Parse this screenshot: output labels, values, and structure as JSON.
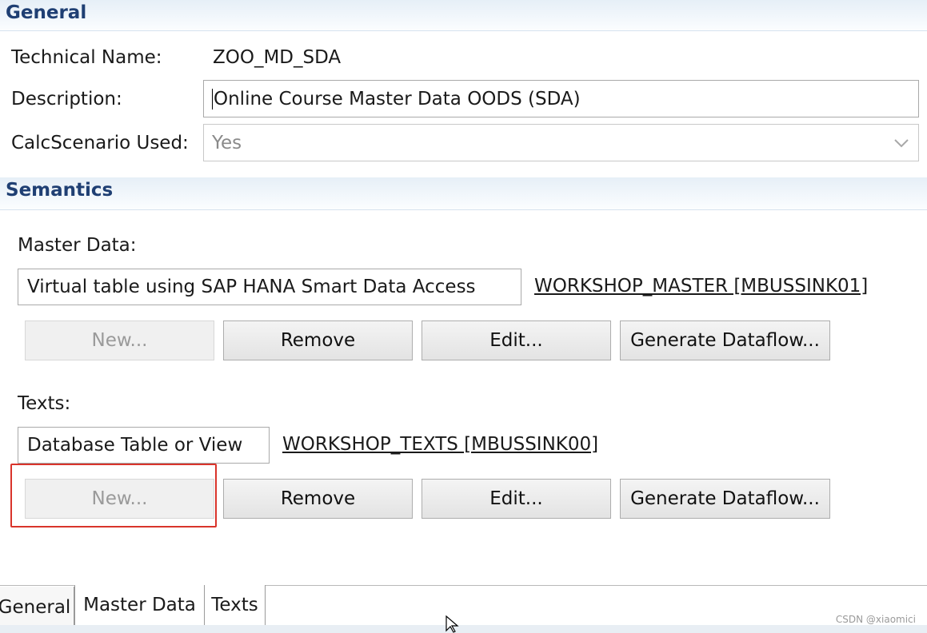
{
  "general": {
    "header": "General",
    "technical_name_label": "Technical Name:",
    "technical_name_value": "ZOO_MD_SDA",
    "description_label": "Description:",
    "description_value": "Online Course Master Data OODS (SDA)",
    "calc_label": "CalcScenario Used:",
    "calc_value": "Yes"
  },
  "semantics": {
    "header": "Semantics",
    "master": {
      "label": "Master Data:",
      "type": "Virtual table using SAP HANA Smart Data Access",
      "link": "WORKSHOP_MASTER [MBUSSINK01]",
      "buttons": {
        "new": "New...",
        "remove": "Remove",
        "edit": "Edit...",
        "generate": "Generate Dataflow..."
      }
    },
    "texts": {
      "label": "Texts:",
      "type": "Database Table or View",
      "link": "WORKSHOP_TEXTS [MBUSSINK00]",
      "buttons": {
        "new": "New...",
        "remove": "Remove",
        "edit": "Edit...",
        "generate": "Generate Dataflow..."
      }
    }
  },
  "tabs": [
    {
      "label": "General",
      "active": true
    },
    {
      "label": "Master Data",
      "active": false
    },
    {
      "label": "Texts",
      "active": false
    }
  ],
  "watermark": "CSDN @xiaomici",
  "colors": {
    "header_text": "#1f3f73",
    "highlight": "#d9342b"
  }
}
